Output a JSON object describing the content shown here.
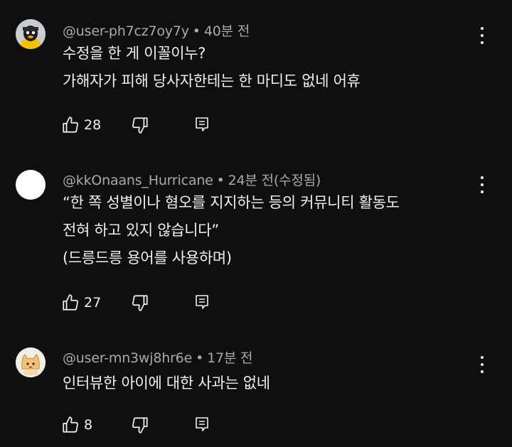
{
  "comments": [
    {
      "author": "@user-ph7cz7oy7y",
      "separator": "•",
      "time": "40분 전",
      "lines": [
        "수정을 한 게 이꼴이누?",
        "가해자가 피해 당사자한테는 한 마디도 없네 어휴"
      ],
      "likes": "28",
      "avatar": "duck-avatar"
    },
    {
      "author": "@kkOnaans_Hurricane",
      "separator": "•",
      "time": "24분 전(수정됨)",
      "lines": [
        "“한 쪽 성별이나 혐오를 지지하는 등의 커뮤니티 활동도",
        "전혀 하고 있지 않습니다”",
        "(드릉드릉 용어를 사용하며)"
      ],
      "likes": "27",
      "avatar": "blank-avatar"
    },
    {
      "author": "@user-mn3wj8hr6e",
      "separator": "•",
      "time": "17분 전",
      "lines": [
        "인터뷰한 아이에 대한 사과는 없네"
      ],
      "likes": "8",
      "avatar": "cat-avatar"
    }
  ],
  "icons": {
    "like": "thumbs-up-icon",
    "dislike": "thumbs-down-icon",
    "reply": "reply-icon",
    "menu": "more-vert-icon"
  },
  "colors": {
    "background": "#0f0f0f",
    "text": "#f1f1f1",
    "meta": "#aaaaaa"
  }
}
